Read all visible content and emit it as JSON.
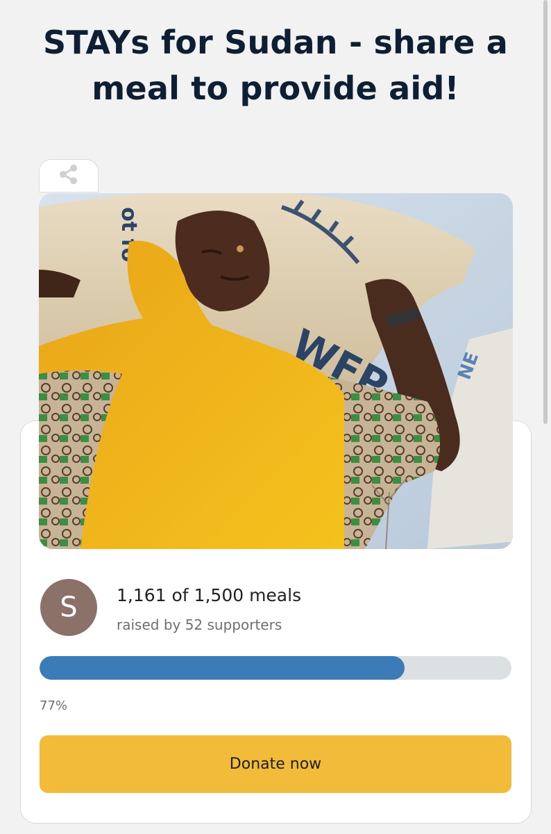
{
  "page": {
    "title_line1": "STAYs for Sudan - share a",
    "title_line2": "meal to provide aid!"
  },
  "share": {
    "icon": "share-icon"
  },
  "hero": {
    "sack_text_main": "WFP",
    "sack_text_side": "ot fo",
    "sack_text_right": "NE"
  },
  "campaign": {
    "avatar_letter": "S",
    "progress_text": "1,161 of 1,500 meals",
    "supporters_text": "raised by 52 supporters",
    "percent_label": "77%",
    "progress_fraction": 0.774,
    "donate_label": "Donate now"
  },
  "colors": {
    "accent_blue": "#3a7bb8",
    "donate_yellow": "#f2bc3a",
    "title_navy": "#0e1f33",
    "avatar_brown": "#8c7168"
  }
}
